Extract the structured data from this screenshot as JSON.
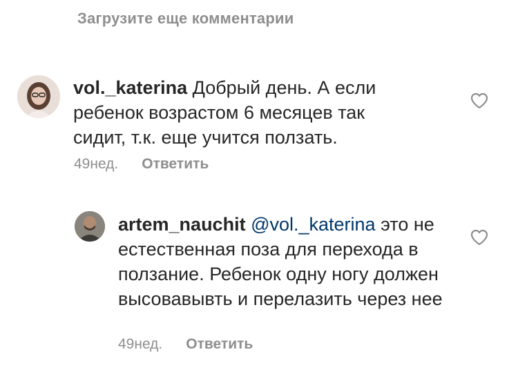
{
  "load_more_label": "Загрузите еще комментарии",
  "comments": [
    {
      "username": "vol._katerina",
      "text": "Добрый день. А если ребенок возрастом 6 месяцев так сидит, т.к. еще учится ползать.",
      "time": "49нед.",
      "reply_label": "Ответить"
    },
    {
      "username": "artem_nauchit",
      "mention": "@vol._katerina",
      "text": "это не естественная поза для перехода в ползание. Ребенок одну ногу должен высовавывть и перелазить через нее",
      "time": "49нед.",
      "reply_label": "Ответить"
    }
  ],
  "icons": {
    "like": "heart-outline-icon"
  },
  "colors": {
    "text": "#262626",
    "secondary": "#8e8e8e",
    "mention": "#00376b"
  }
}
